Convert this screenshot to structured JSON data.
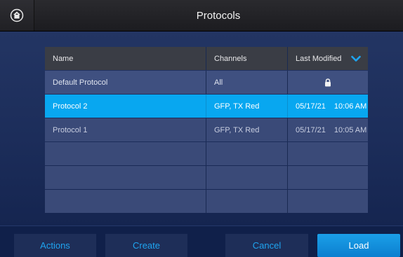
{
  "header": {
    "title": "Protocols",
    "home_icon": "home-icon"
  },
  "table": {
    "columns": [
      "Name",
      "Channels",
      "Last Modified"
    ],
    "sort_icon": "chevron-down-icon",
    "rows": [
      {
        "name": "Default Protocol",
        "channels": "All",
        "locked": true,
        "lock_icon": "lock-icon"
      },
      {
        "name": "Protocol 2",
        "channels": "GFP, TX Red",
        "date": "05/17/21",
        "time": "10:06 AM",
        "selected": true
      },
      {
        "name": "Protocol 1",
        "channels": "GFP, TX Red",
        "date": "05/17/21",
        "time": "10:05 AM"
      }
    ]
  },
  "footer": {
    "actions": "Actions",
    "create": "Create",
    "cancel": "Cancel",
    "load": "Load"
  },
  "colors": {
    "accent": "#08a7f0",
    "link": "#1ea4f0",
    "background": "#1c2d5a"
  }
}
